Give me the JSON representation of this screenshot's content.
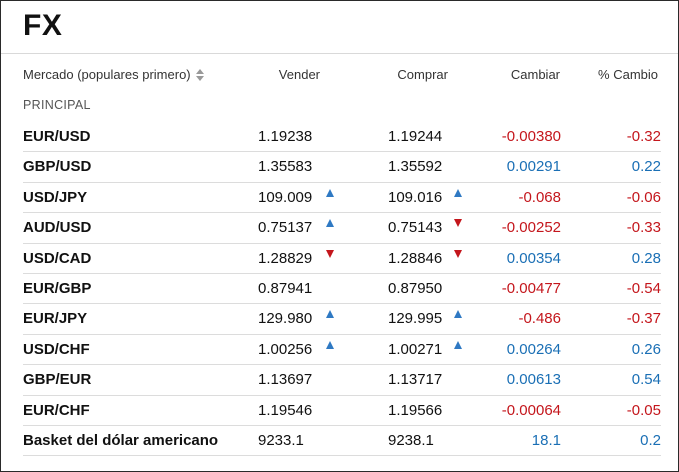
{
  "title": "FX",
  "header": {
    "market": "Mercado (populares primero)",
    "sell": "Vender",
    "buy": "Comprar",
    "change": "Cambiar",
    "pct_change": "% Cambio"
  },
  "section": "PRINCIPAL",
  "colors": {
    "negative": "#c4161c",
    "positive": "#1a6fb5",
    "arrow_up": "#2f79c3",
    "arrow_down": "#c4161c"
  },
  "rows": [
    {
      "market": "EUR/USD",
      "sell": "1.19238",
      "sell_arrow": "",
      "buy": "1.19244",
      "buy_arrow": "",
      "change": "-0.00380",
      "pct": "-0.32",
      "dir": "neg"
    },
    {
      "market": "GBP/USD",
      "sell": "1.35583",
      "sell_arrow": "",
      "buy": "1.35592",
      "buy_arrow": "",
      "change": "0.00291",
      "pct": "0.22",
      "dir": "pos"
    },
    {
      "market": "USD/JPY",
      "sell": "109.009",
      "sell_arrow": "up",
      "buy": "109.016",
      "buy_arrow": "up",
      "change": "-0.068",
      "pct": "-0.06",
      "dir": "neg"
    },
    {
      "market": "AUD/USD",
      "sell": "0.75137",
      "sell_arrow": "up",
      "buy": "0.75143",
      "buy_arrow": "down",
      "change": "-0.00252",
      "pct": "-0.33",
      "dir": "neg"
    },
    {
      "market": "USD/CAD",
      "sell": "1.28829",
      "sell_arrow": "down",
      "buy": "1.28846",
      "buy_arrow": "down",
      "change": "0.00354",
      "pct": "0.28",
      "dir": "pos"
    },
    {
      "market": "EUR/GBP",
      "sell": "0.87941",
      "sell_arrow": "",
      "buy": "0.87950",
      "buy_arrow": "",
      "change": "-0.00477",
      "pct": "-0.54",
      "dir": "neg"
    },
    {
      "market": "EUR/JPY",
      "sell": "129.980",
      "sell_arrow": "up",
      "buy": "129.995",
      "buy_arrow": "up",
      "change": "-0.486",
      "pct": "-0.37",
      "dir": "neg"
    },
    {
      "market": "USD/CHF",
      "sell": "1.00256",
      "sell_arrow": "up",
      "buy": "1.00271",
      "buy_arrow": "up",
      "change": "0.00264",
      "pct": "0.26",
      "dir": "pos"
    },
    {
      "market": "GBP/EUR",
      "sell": "1.13697",
      "sell_arrow": "",
      "buy": "1.13717",
      "buy_arrow": "",
      "change": "0.00613",
      "pct": "0.54",
      "dir": "pos"
    },
    {
      "market": "EUR/CHF",
      "sell": "1.19546",
      "sell_arrow": "",
      "buy": "1.19566",
      "buy_arrow": "",
      "change": "-0.00064",
      "pct": "-0.05",
      "dir": "neg"
    },
    {
      "market": "Basket del dólar americano",
      "sell": "9233.1",
      "sell_arrow": "",
      "buy": "9238.1",
      "buy_arrow": "",
      "change": "18.1",
      "pct": "0.2",
      "dir": "pos"
    }
  ]
}
